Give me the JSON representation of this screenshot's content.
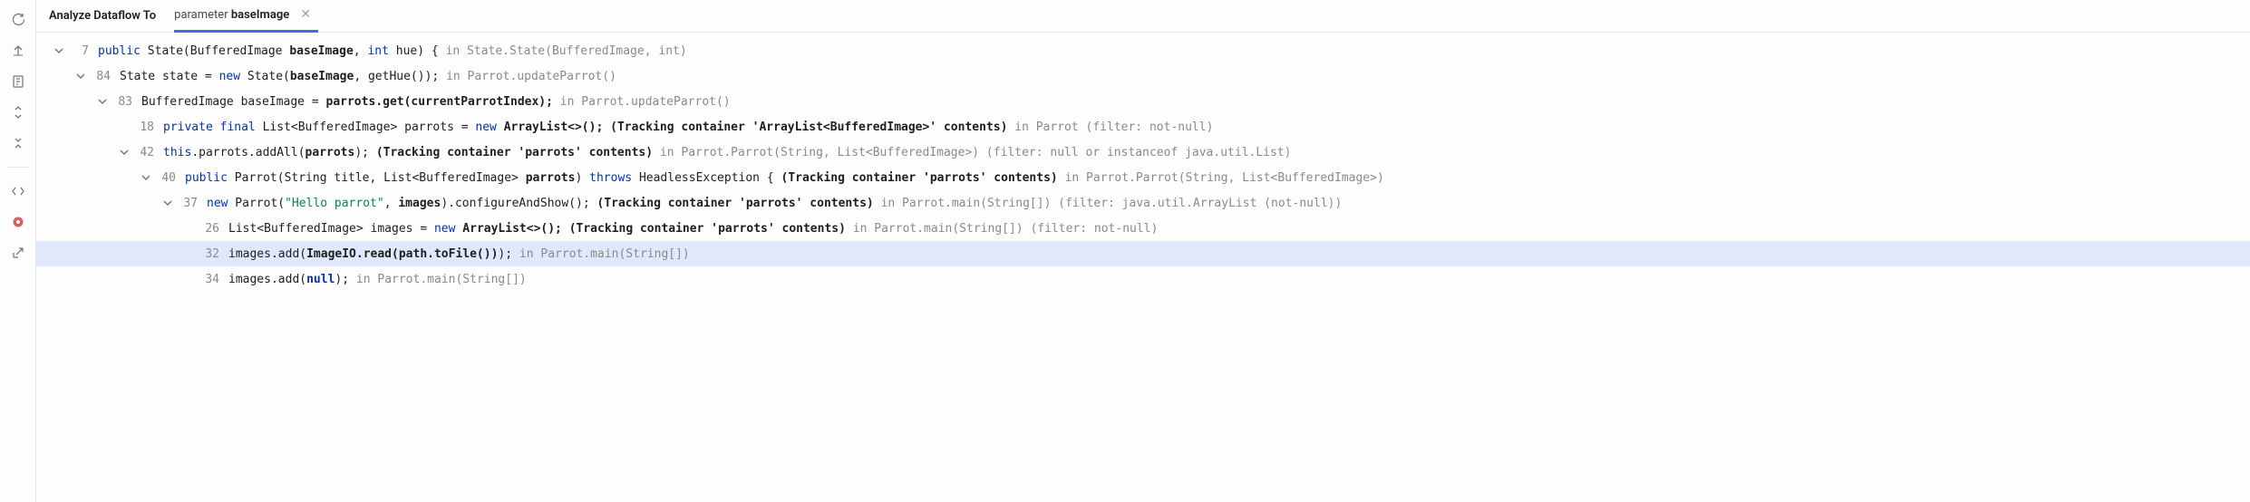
{
  "tabs": {
    "static_label": "Analyze Dataflow To",
    "active_prefix": "parameter ",
    "active_bold": "baseImage"
  },
  "tree": {
    "row0": {
      "ln": "7",
      "kw_public": "public",
      "t1": " State(BufferedImage ",
      "b1": "baseImage",
      "t2": ", ",
      "kw_int": "int",
      "t3": " hue) { ",
      "loc": "in State.State(BufferedImage, int)"
    },
    "row1": {
      "ln": "84",
      "t1": "State state = ",
      "kw_new": "new",
      "t2": " State(",
      "b1": "baseImage",
      "t3": ", getHue()); ",
      "loc": "in Parrot.updateParrot()"
    },
    "row2": {
      "ln": "83",
      "t1": "BufferedImage baseImage = ",
      "b1": "parrots.get(currentParrotIndex);",
      "t2": " ",
      "loc": "in Parrot.updateParrot()"
    },
    "row3": {
      "ln": "18",
      "kw_private": "private",
      "kw_final": "final",
      "t1": " List<BufferedImage> parrots = ",
      "kw_new": "new",
      "t2": " ",
      "b1": "ArrayList<>();",
      "t3": " ",
      "b2": "(Tracking container 'ArrayList<BufferedImage>' contents)",
      "loc": " in Parrot (filter: not-null)"
    },
    "row4": {
      "ln": "42",
      "kw_this": "this",
      "t1": ".parrots.addAll(",
      "b1": "parrots",
      "t2": "); ",
      "b2": "(Tracking container 'parrots' contents)",
      "loc": " in Parrot.Parrot(String, List<BufferedImage>) (filter: null or instanceof java.util.List)"
    },
    "row5": {
      "ln": "40",
      "kw_public": "public",
      "t1": " Parrot(String title, List<BufferedImage> ",
      "b1": "parrots",
      "t2": ") ",
      "kw_throws": "throws",
      "t3": " HeadlessException { ",
      "b2": "(Tracking container 'parrots' contents)",
      "loc": " in Parrot.Parrot(String, List<BufferedImage>)"
    },
    "row6": {
      "ln": "37",
      "kw_new": "new",
      "t1": " Parrot(",
      "str": "\"Hello parrot\"",
      "t2": ", ",
      "b1": "images",
      "t3": ").configureAndShow(); ",
      "b2": "(Tracking container 'parrots' contents)",
      "loc": " in Parrot.main(String[]) (filter: java.util.ArrayList (not-null))"
    },
    "row7": {
      "ln": "26",
      "t1": "List<BufferedImage> images = ",
      "kw_new": "new",
      "t2": " ",
      "b1": "ArrayList<>();",
      "t3": " ",
      "b2": "(Tracking container 'parrots' contents)",
      "loc": " in Parrot.main(String[]) (filter: not-null)"
    },
    "row8": {
      "ln": "32",
      "t1": "images.add(",
      "b1": "ImageIO.read(path.toFile())",
      "t2": "); ",
      "loc": "in Parrot.main(String[])"
    },
    "row9": {
      "ln": "34",
      "t1": "images.add(",
      "kw_null": "null",
      "t2": "); ",
      "loc": "in Parrot.main(String[])"
    }
  }
}
